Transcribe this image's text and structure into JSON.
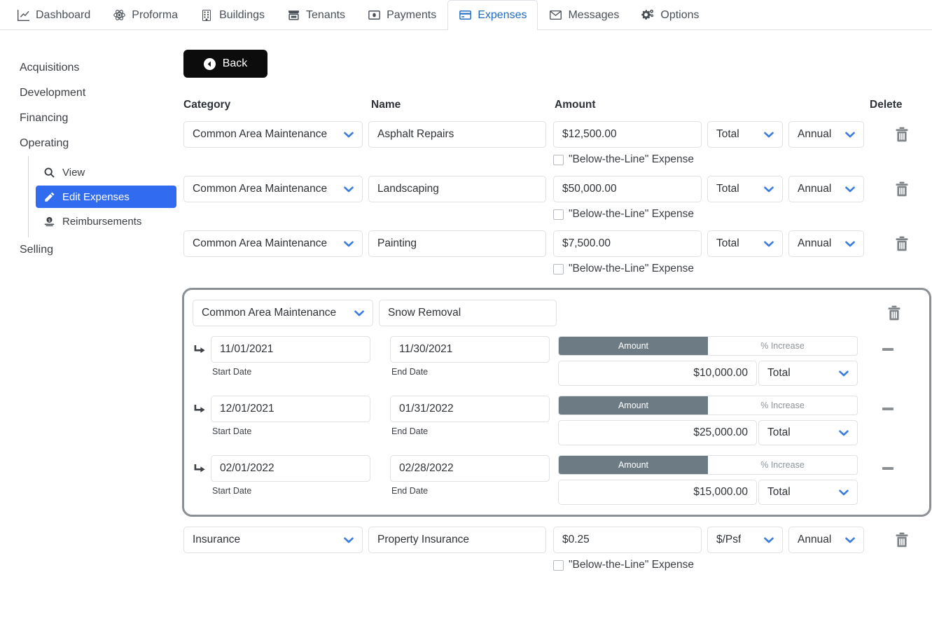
{
  "tabs": [
    {
      "label": "Dashboard",
      "icon": "chart-line-icon",
      "active": false
    },
    {
      "label": "Proforma",
      "icon": "atom-icon",
      "active": false
    },
    {
      "label": "Buildings",
      "icon": "building-icon",
      "active": false
    },
    {
      "label": "Tenants",
      "icon": "store-icon",
      "active": false
    },
    {
      "label": "Payments",
      "icon": "money-card-icon",
      "active": false
    },
    {
      "label": "Expenses",
      "icon": "credit-card-icon",
      "active": true
    },
    {
      "label": "Messages",
      "icon": "envelope-icon",
      "active": false
    },
    {
      "label": "Options",
      "icon": "gears-icon",
      "active": false
    }
  ],
  "sidebar": {
    "items": [
      {
        "label": "Acquisitions"
      },
      {
        "label": "Development"
      },
      {
        "label": "Financing"
      },
      {
        "label": "Operating"
      },
      {
        "label": "Selling"
      }
    ],
    "subitems": [
      {
        "label": "View",
        "icon": "search-icon",
        "active": false
      },
      {
        "label": "Edit Expenses",
        "icon": "pencil-icon",
        "active": true
      },
      {
        "label": "Reimbursements",
        "icon": "money-hand-icon",
        "active": false
      }
    ]
  },
  "toolbar": {
    "back_label": "Back",
    "back_icon": "arrow-circle-left-icon"
  },
  "columns": {
    "category": "Category",
    "name": "Name",
    "amount": "Amount",
    "delete": "Delete"
  },
  "labels": {
    "below_the_line": "\"Below-the-Line\" Expense",
    "start_date": "Start Date",
    "end_date": "End Date",
    "amount_toggle": "Amount",
    "percent_toggle": "% Increase",
    "delete_icon": "trash-icon",
    "remove_icon": "minus-icon",
    "nest_icon": "level-down-right-arrow-icon"
  },
  "colors": {
    "accent": "#316bef",
    "chevron": "#3b7ddd",
    "tab_active": "#206bc4",
    "toggle_active_bg": "#6d7c84",
    "group_border": "#8b9094",
    "back_bg": "#0c0c0d"
  },
  "expenses": [
    {
      "category": "Common Area Maintenance",
      "name": "Asphalt Repairs",
      "amount": "$12,500.00",
      "unit": "Total",
      "frequency": "Annual",
      "below_the_line": false
    },
    {
      "category": "Common Area Maintenance",
      "name": "Landscaping",
      "amount": "$50,000.00",
      "unit": "Total",
      "frequency": "Annual",
      "below_the_line": false
    },
    {
      "category": "Common Area Maintenance",
      "name": "Painting",
      "amount": "$7,500.00",
      "unit": "Total",
      "frequency": "Annual",
      "below_the_line": false
    }
  ],
  "group_expense": {
    "category": "Common Area Maintenance",
    "name": "Snow Removal",
    "selected": true,
    "schedule": [
      {
        "start_date": "11/01/2021",
        "end_date": "11/30/2021",
        "mode": "Amount",
        "amount": "$10,000.00",
        "unit": "Total"
      },
      {
        "start_date": "12/01/2021",
        "end_date": "01/31/2022",
        "mode": "Amount",
        "amount": "$25,000.00",
        "unit": "Total"
      },
      {
        "start_date": "02/01/2022",
        "end_date": "02/28/2022",
        "mode": "Amount",
        "amount": "$15,000.00",
        "unit": "Total"
      }
    ]
  },
  "expenses_after": [
    {
      "category": "Insurance",
      "name": "Property Insurance",
      "amount": "$0.25",
      "unit": "$/Psf",
      "frequency": "Annual",
      "below_the_line": false
    }
  ]
}
